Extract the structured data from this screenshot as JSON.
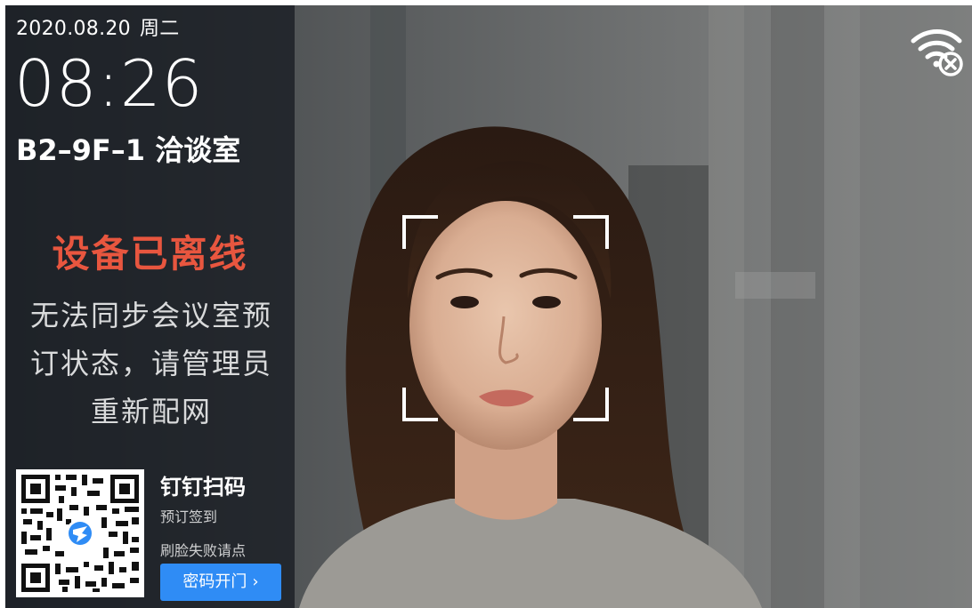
{
  "header": {
    "date": "2020.08.20",
    "weekday": "周二",
    "time": "08:26",
    "room": "B2–9F–1 洽谈室"
  },
  "status": {
    "title": "设备已离线",
    "description_lines": [
      "无法同步会议室预",
      "订状态，请管理员",
      "重新配网"
    ],
    "title_color": "#e8563f"
  },
  "qr_section": {
    "title": "钉钉扫码",
    "subtitle": "预订签到",
    "fail_hint": "刷脸失败请点",
    "button_label": "密码开门",
    "button_icon": "chevron-right-icon",
    "button_color": "#2f8cf5"
  },
  "indicators": {
    "network_icon": "wifi-disconnected-icon"
  },
  "camera": {
    "face_frame_icon": "face-detection-frame"
  }
}
